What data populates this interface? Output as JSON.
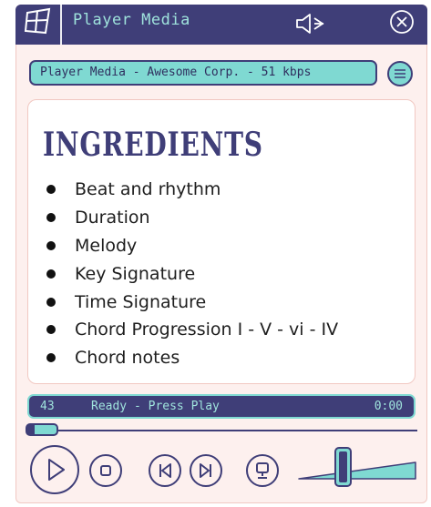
{
  "window": {
    "title": "Player Media",
    "icons": [
      "windows-logo-icon",
      "speaker-mute-icon",
      "close-circle-icon"
    ]
  },
  "info_bar": {
    "text": "Player Media - Awesome Corp. - 51 kbps",
    "menu_icon": "hamburger-menu-icon"
  },
  "content": {
    "heading": "INGREDIENTS",
    "items": [
      "Beat and rhythm",
      "Duration",
      "Melody",
      "Key Signature",
      "Time Signature",
      "Chord Progression I - V - vi - IV",
      "Chord notes"
    ]
  },
  "status_bar": {
    "track_number": "43",
    "message": "Ready - Press Play",
    "time": "0:00"
  },
  "seek": {
    "progress": 0.0
  },
  "controls": [
    "play-icon",
    "stop-icon",
    "previous-icon",
    "next-icon",
    "screen-icon"
  ],
  "volume": {
    "level": 0.4
  },
  "colors": {
    "navy": "#3f3e78",
    "teal": "#7fd9d2",
    "mint_text": "#9fe3dc",
    "window_bg": "#fdf0ee",
    "border_pink": "#f1c8c2"
  }
}
